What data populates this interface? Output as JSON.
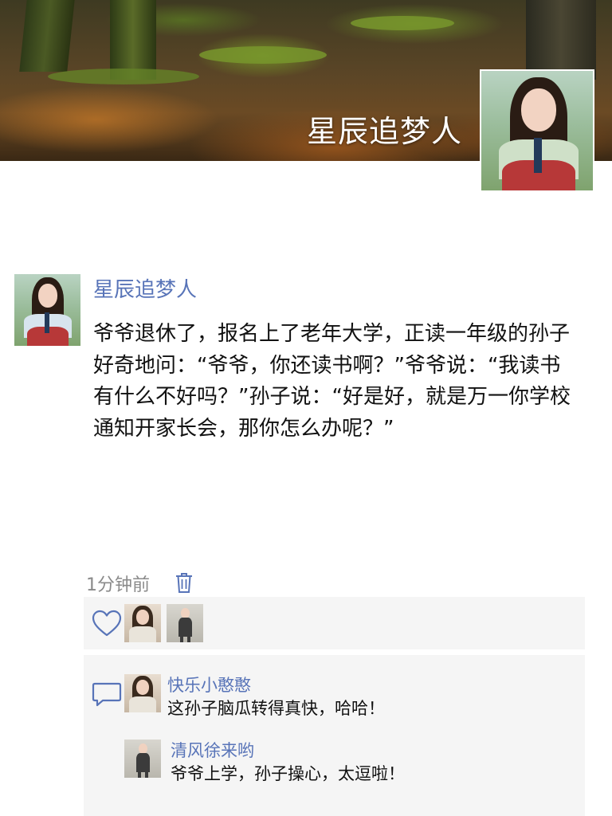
{
  "profile": {
    "cover_name": "星辰追梦人"
  },
  "post": {
    "author": "星辰追梦人",
    "text": "爷爷退休了，报名上了老年大学，正读一年级的孙子好奇地问：“爷爷，你还读书啊？”爷爷说：“我读书有什么不好吗？”孙子说：“好是好，就是万一你学校通知开家长会，那你怎么办呢？”",
    "time": "1分钟前"
  },
  "comments": [
    {
      "author": "快乐小憨憨",
      "text": "这孙子脑瓜转得真快，哈哈！"
    },
    {
      "author": "清风徐来哟",
      "text": "爷爷上学，孙子操心，太逗啦！"
    }
  ],
  "colors": {
    "name_blue": "#5874b8",
    "panel_bg": "#f5f5f5",
    "time_gray": "#8a8a8a"
  },
  "icons": {
    "delete": "trash-icon",
    "like": "heart-icon",
    "comment": "comment-bubble-icon"
  }
}
